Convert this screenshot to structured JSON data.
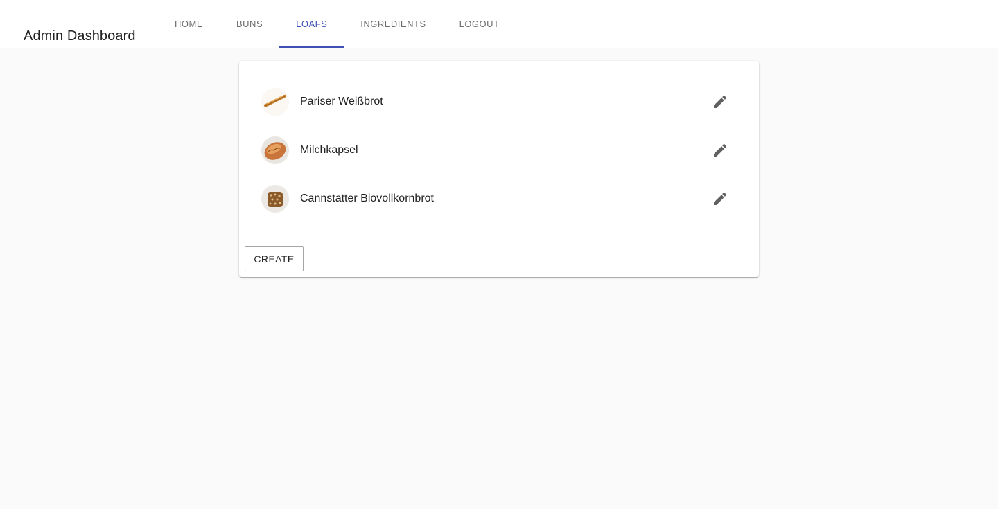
{
  "app": {
    "title": "Admin Dashboard"
  },
  "nav": {
    "tabs": [
      {
        "label": "HOME",
        "active": false
      },
      {
        "label": "BUNS",
        "active": false
      },
      {
        "label": "LOAFS",
        "active": true
      },
      {
        "label": "INGREDIENTS",
        "active": false
      },
      {
        "label": "LOGOUT",
        "active": false
      }
    ]
  },
  "loafs": {
    "items": [
      {
        "name": "Pariser Weißbrot",
        "image_icon": "baguette-image",
        "action_icon": "pencil-icon"
      },
      {
        "name": "Milchkapsel",
        "image_icon": "milk-loaf-image",
        "action_icon": "pencil-icon"
      },
      {
        "name": "Cannstatter Biovollkornbrot",
        "image_icon": "wholegrain-bread-image",
        "action_icon": "pencil-icon"
      }
    ],
    "create_label": "CREATE"
  },
  "colors": {
    "accent": "#3f51b5",
    "background": "#fafafa",
    "surface": "#ffffff",
    "icon": "#616161"
  }
}
